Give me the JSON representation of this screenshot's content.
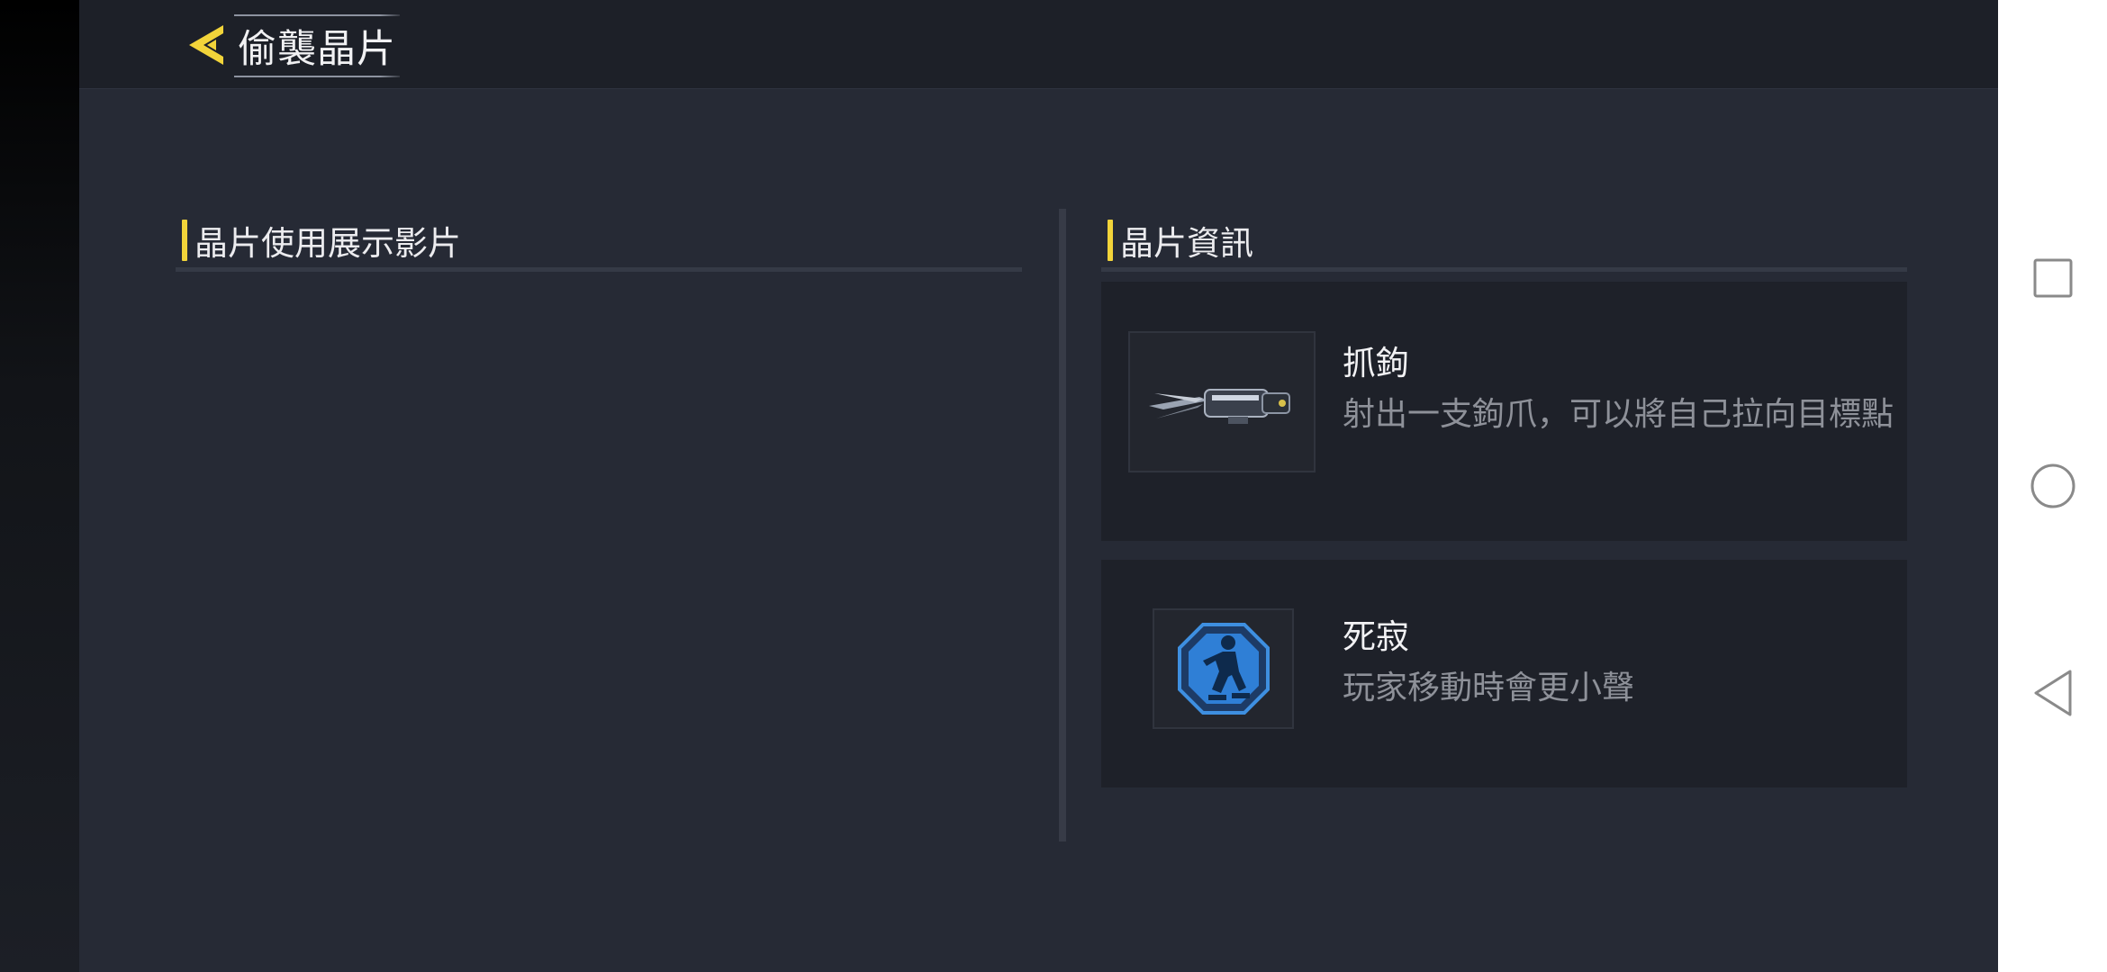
{
  "header": {
    "title": "偷襲晶片"
  },
  "video_section": {
    "title": "晶片使用展示影片"
  },
  "info_section": {
    "title": "晶片資訊"
  },
  "chips": [
    {
      "name": "抓鉤",
      "description": "射出一支鉤爪，可以將自己拉向目標點",
      "icon": "grappling-hook-icon"
    },
    {
      "name": "死寂",
      "description": "玩家移動時會更小聲",
      "icon": "silent-step-icon"
    }
  ],
  "colors": {
    "accent": "#f2d43a",
    "background": "#262a35",
    "card": "#1e2129",
    "muted_text": "#8e9199"
  },
  "system_nav": {
    "icons": [
      "recent-apps-icon",
      "home-icon",
      "back-icon"
    ]
  }
}
